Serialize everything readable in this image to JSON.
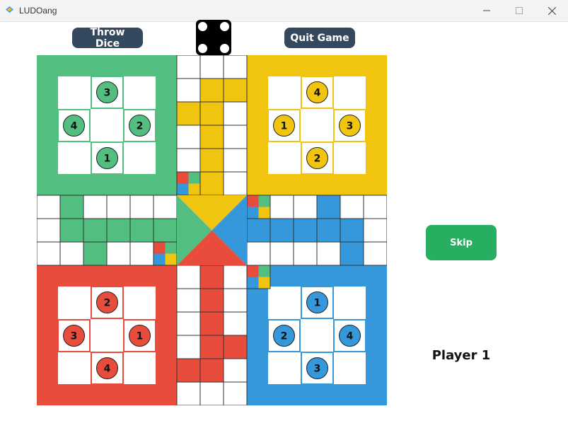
{
  "window": {
    "title": "LUDOang"
  },
  "controls": {
    "throw_dice_label": "Throw Dice",
    "quit_game_label": "Quit Game",
    "skip_label": "Skip"
  },
  "dice": {
    "value": 4,
    "face": "dice-four"
  },
  "status": {
    "current_player": "Player 1"
  },
  "colors": {
    "green": "#52be80",
    "yellow": "#f1c40f",
    "red": "#e74c3c",
    "blue": "#3498db",
    "dark_button": "#34495e",
    "skip_button": "#27ae60"
  },
  "homes": [
    {
      "color": "green",
      "quadrant": "top-left",
      "tokens": {
        "top": "3",
        "left": "4",
        "right": "2",
        "bottom": "1"
      }
    },
    {
      "color": "yellow",
      "quadrant": "top-right",
      "tokens": {
        "top": "4",
        "left": "1",
        "right": "3",
        "bottom": "2"
      }
    },
    {
      "color": "red",
      "quadrant": "bottom-left",
      "tokens": {
        "top": "2",
        "left": "3",
        "right": "1",
        "bottom": "4"
      }
    },
    {
      "color": "blue",
      "quadrant": "bottom-right",
      "tokens": {
        "top": "1",
        "left": "2",
        "right": "4",
        "bottom": "3"
      }
    }
  ]
}
